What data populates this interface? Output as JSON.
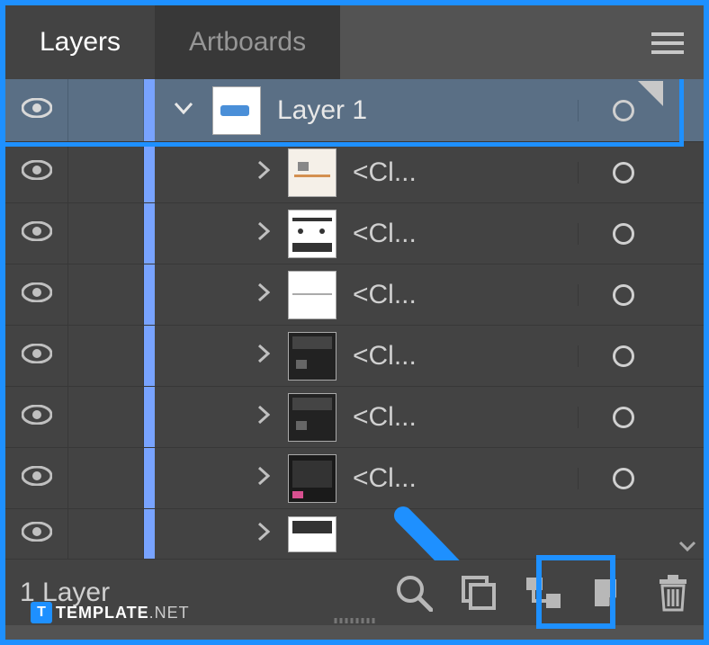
{
  "tabs": {
    "layers": "Layers",
    "artboards": "Artboards"
  },
  "mainLayer": {
    "name": "Layer 1"
  },
  "subLayers": [
    {
      "name": "<Cl..."
    },
    {
      "name": "<Cl..."
    },
    {
      "name": "<Cl..."
    },
    {
      "name": "<Cl..."
    },
    {
      "name": "<Cl..."
    },
    {
      "name": "<Cl..."
    }
  ],
  "statusBar": {
    "count": "1 Layer"
  },
  "watermark": {
    "icon": "T",
    "brand": "TEMPLATE",
    "suffix": ".NET"
  },
  "colors": {
    "highlight": "#1e90ff",
    "layerBar": "#78a3ff"
  }
}
